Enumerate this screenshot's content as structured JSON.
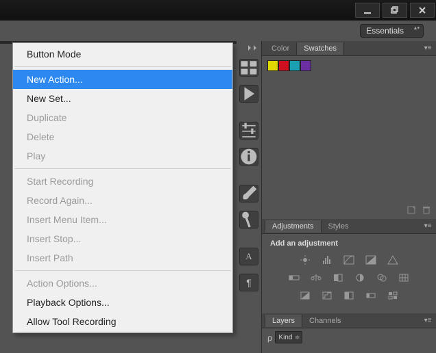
{
  "window": {
    "min_tip": "Minimize",
    "max_tip": "Restore",
    "close_tip": "Close"
  },
  "workspace": {
    "label": "Essentials"
  },
  "dock": {
    "history_tip": "History",
    "actions_tip": "Actions",
    "properties_tip": "Properties",
    "info_tip": "Info",
    "brush_tip": "Brush",
    "brushpresets_tip": "Brush Presets",
    "char_tip": "Character",
    "para_tip": "Paragraph"
  },
  "color_panel": {
    "tab_color": "Color",
    "tab_swatches": "Swatches",
    "swatches": [
      "#e0d800",
      "#d01020",
      "#1aa0b0",
      "#6a2fa0"
    ]
  },
  "adjustments_panel": {
    "tab_adjustments": "Adjustments",
    "tab_styles": "Styles",
    "title": "Add an adjustment"
  },
  "layers_panel": {
    "tab_layers": "Layers",
    "tab_channels": "Channels",
    "filter_icon_label": "ρ",
    "kind_label": "Kind"
  },
  "menu": {
    "button_mode": "Button Mode",
    "new_action": "New Action...",
    "new_set": "New Set...",
    "duplicate": "Duplicate",
    "delete": "Delete",
    "play": "Play",
    "start_recording": "Start Recording",
    "record_again": "Record Again...",
    "insert_menu_item": "Insert Menu Item...",
    "insert_stop": "Insert Stop...",
    "insert_path": "Insert Path",
    "action_options": "Action Options...",
    "playback_options": "Playback Options...",
    "allow_tool_recording": "Allow Tool Recording"
  }
}
